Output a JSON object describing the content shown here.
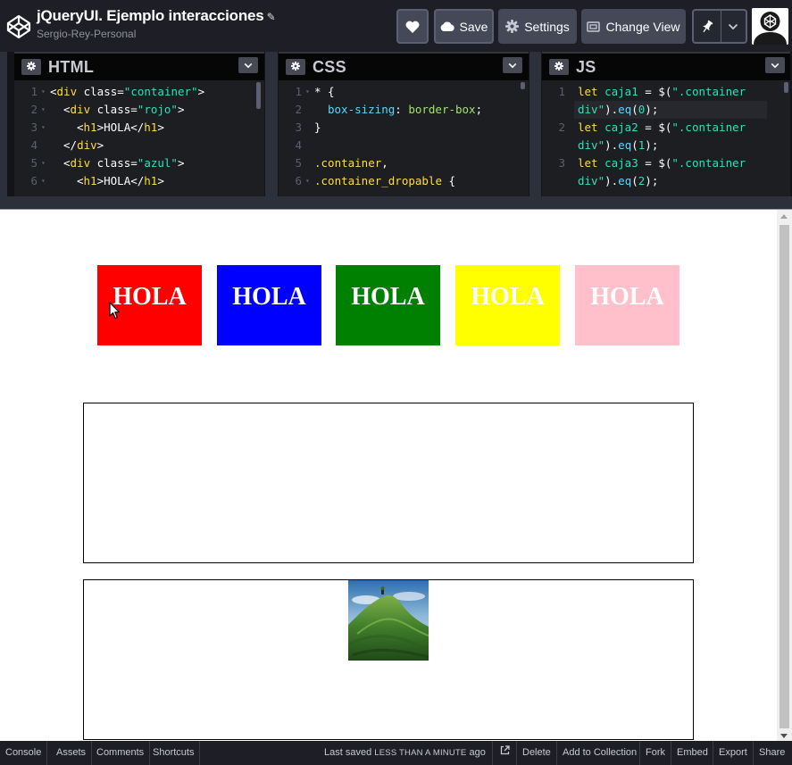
{
  "header": {
    "title": "jQueryUI. Ejemplo interacciones",
    "author": "Sergio-Rey-Personal",
    "save_label": "Save",
    "settings_label": "Settings",
    "change_view_label": "Change View"
  },
  "editors": {
    "html": {
      "name": "HTML",
      "lines": [
        {
          "n": "1",
          "fold": "▾"
        },
        {
          "n": "2",
          "fold": "▾"
        },
        {
          "n": "3",
          "fold": "▾"
        },
        {
          "n": "4",
          "fold": ""
        },
        {
          "n": "5",
          "fold": "▾"
        },
        {
          "n": "6",
          "fold": "▾"
        }
      ],
      "code": {
        "l1_open": "<",
        "l1_tag": "div",
        "l1_attr": " class=",
        "l1_str": "\"container\"",
        "l1_close": ">",
        "l2_open": "<",
        "l2_tag": "div",
        "l2_attr": " class=",
        "l2_str": "\"rojo\"",
        "l2_close": ">",
        "l3_open": "<",
        "l3_tag": "h1",
        "l3_mid": ">HOLA</",
        "l3_tag2": "h1",
        "l3_close": ">",
        "l4_open": "</",
        "l4_tag": "div",
        "l4_close": ">",
        "l5_open": "<",
        "l5_tag": "div",
        "l5_attr": " class=",
        "l5_str": "\"azul\"",
        "l5_close": ">",
        "l6_open": "<",
        "l6_tag": "h1",
        "l6_mid": ">HOLA</",
        "l6_tag2": "h1",
        "l6_close": ">"
      }
    },
    "css": {
      "name": "CSS",
      "lines": [
        {
          "n": "1",
          "fold": "▾"
        },
        {
          "n": "2",
          "fold": ""
        },
        {
          "n": "3",
          "fold": ""
        },
        {
          "n": "4",
          "fold": ""
        },
        {
          "n": "5",
          "fold": ""
        },
        {
          "n": "6",
          "fold": "▾"
        }
      ],
      "code": {
        "l1": "* {",
        "l2_prop": "box-sizing",
        "l2_colon": ": ",
        "l2_val": "border-box",
        "l2_semi": ";",
        "l3": "}",
        "l5_sel": ".container",
        "l5_comma": ",",
        "l6_sel": ".container_dropable",
        "l6_brace": " {"
      }
    },
    "js": {
      "name": "JS",
      "lines": [
        {
          "n": "1"
        },
        {
          "n": "2"
        },
        {
          "n": "3"
        }
      ],
      "code": {
        "l1a_kw": "let",
        "l1a_var": " caja1",
        "l1a_eq": " = ",
        "l1a_fn": "$(",
        "l1a_str": "\".container",
        "l1b_str": "div\"",
        "l1b_rest": ").",
        "l1b_fn": "eq",
        "l1b_p": "(",
        "l1b_num": "0",
        "l1b_end": ");",
        "l2a_kw": "let",
        "l2a_var": " caja2",
        "l2a_eq": " = ",
        "l2a_fn": "$(",
        "l2a_str": "\".container",
        "l2b_str": "div\"",
        "l2b_rest": ").",
        "l2b_fn": "eq",
        "l2b_p": "(",
        "l2b_num": "1",
        "l2b_end": ");",
        "l3a_kw": "let",
        "l3a_var": " caja3",
        "l3a_eq": " = ",
        "l3a_fn": "$(",
        "l3a_str": "\".container",
        "l3b_str": "div\"",
        "l3b_rest": ").",
        "l3b_fn": "eq",
        "l3b_p": "(",
        "l3b_num": "2",
        "l3b_end": ");"
      }
    }
  },
  "preview": {
    "boxes": [
      {
        "text": "HOLA",
        "color": "#ff0000"
      },
      {
        "text": "HOLA",
        "color": "#0000ff"
      },
      {
        "text": "HOLA",
        "color": "#008000"
      },
      {
        "text": "HOLA",
        "color": "#ffff00"
      },
      {
        "text": "HOLA",
        "color": "#ffc0cb"
      }
    ]
  },
  "footer": {
    "console": "Console",
    "assets": "Assets",
    "comments": "Comments",
    "shortcuts": "Shortcuts",
    "last_saved_prefix": "Last saved",
    "last_saved_time": "LESS THAN A MINUTE",
    "last_saved_suffix": "ago",
    "delete": "Delete",
    "add_to_collection": "Add to Collection",
    "fork": "Fork",
    "embed": "Embed",
    "export": "Export",
    "share": "Share"
  }
}
